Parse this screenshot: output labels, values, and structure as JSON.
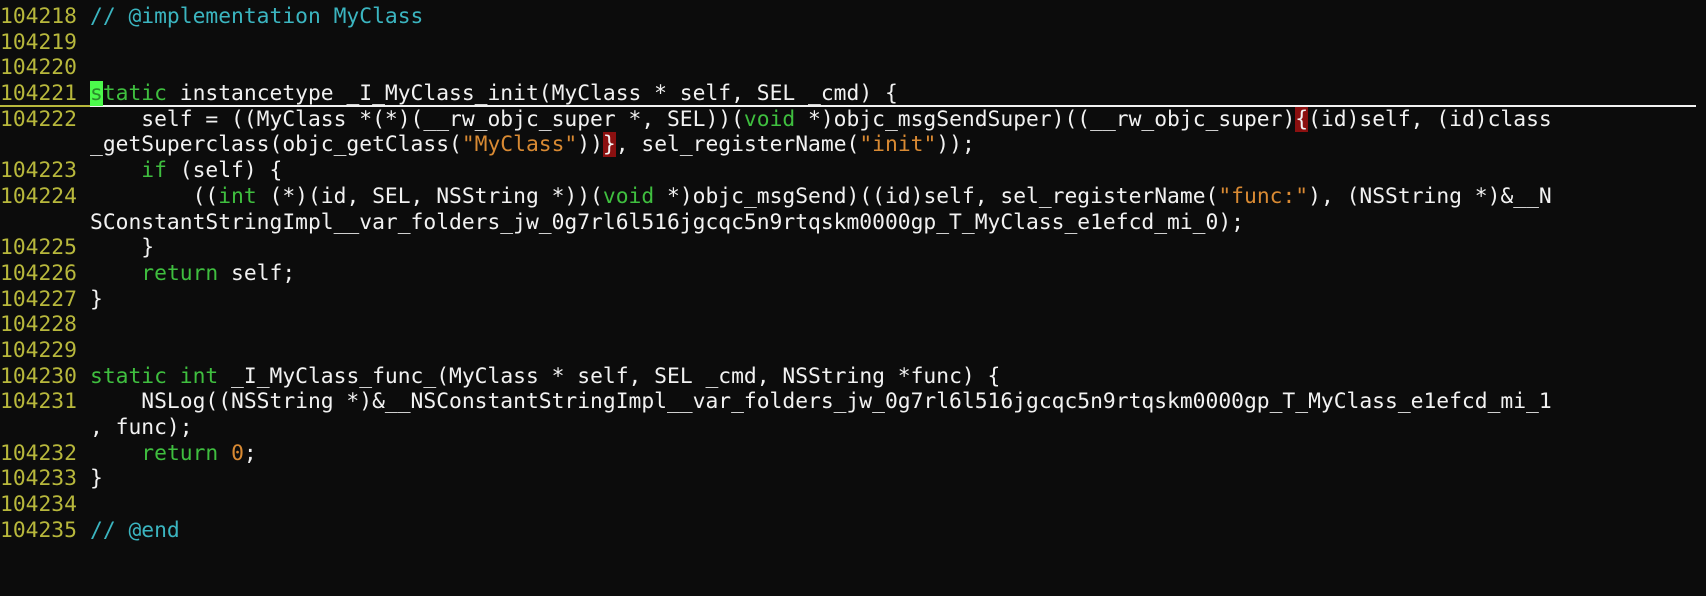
{
  "editor": {
    "colors": {
      "background": "#0c0c0c",
      "line_number": "#b8b83c",
      "comment": "#3bb5c0",
      "keyword": "#3fbf3f",
      "string": "#d98a33",
      "match_bracket_bg": "#8b1010",
      "cursor": "#4cfa4c"
    },
    "rows": [
      {
        "num": "104218",
        "segs": [
          [
            "// @implementation MyClass",
            "comment"
          ]
        ]
      },
      {
        "num": "104219",
        "segs": []
      },
      {
        "num": "104220",
        "segs": []
      },
      {
        "num": "104221",
        "cursorline": true,
        "segs": [
          [
            "s",
            "cursor kw"
          ],
          [
            "tatic",
            "kw"
          ],
          [
            " instancetype _I_MyClass_init(MyClass * self, SEL _cmd) {",
            ""
          ]
        ]
      },
      {
        "num": "104222",
        "segs": [
          [
            "    self = ((MyClass *(*)(__rw_objc_super *, SEL))(",
            ""
          ],
          [
            "void",
            "kw"
          ],
          [
            " *)objc_msgSendSuper)((__rw_objc_super)",
            ""
          ],
          [
            "{",
            "match"
          ],
          [
            "(id)self, (id)class",
            ""
          ]
        ]
      },
      {
        "num": "",
        "segs": [
          [
            "_getSuperclass(objc_getClass(",
            ""
          ],
          [
            "\"MyClass\"",
            "str"
          ],
          [
            "))",
            ""
          ],
          [
            "}",
            "match"
          ],
          [
            ", sel_registerName(",
            ""
          ],
          [
            "\"init\"",
            "str"
          ],
          [
            "));",
            ""
          ]
        ]
      },
      {
        "num": "104223",
        "segs": [
          [
            "    ",
            ""
          ],
          [
            "if",
            "kw"
          ],
          [
            " (self) {",
            ""
          ]
        ]
      },
      {
        "num": "104224",
        "segs": [
          [
            "        ((",
            ""
          ],
          [
            "int",
            "kw"
          ],
          [
            " (*)(id, SEL, NSString *))(",
            ""
          ],
          [
            "void",
            "kw"
          ],
          [
            " *)objc_msgSend)((id)self, sel_registerName(",
            ""
          ],
          [
            "\"func:\"",
            "str"
          ],
          [
            "), (NSString *)&__N",
            ""
          ]
        ]
      },
      {
        "num": "",
        "segs": [
          [
            "SConstantStringImpl__var_folders_jw_0g7rl6l516jgcqc5n9rtqskm0000gp_T_MyClass_e1efcd_mi_0);",
            ""
          ]
        ]
      },
      {
        "num": "104225",
        "segs": [
          [
            "    }",
            ""
          ]
        ]
      },
      {
        "num": "104226",
        "segs": [
          [
            "    ",
            ""
          ],
          [
            "return",
            "kw"
          ],
          [
            " self;",
            ""
          ]
        ]
      },
      {
        "num": "104227",
        "segs": [
          [
            "}",
            ""
          ]
        ]
      },
      {
        "num": "104228",
        "segs": []
      },
      {
        "num": "104229",
        "segs": []
      },
      {
        "num": "104230",
        "segs": [
          [
            "static",
            "kw"
          ],
          [
            " ",
            ""
          ],
          [
            "int",
            "kw"
          ],
          [
            " _I_MyClass_func_(MyClass * self, SEL _cmd, NSString *func) {",
            ""
          ]
        ]
      },
      {
        "num": "104231",
        "segs": [
          [
            "    NSLog((NSString *)&__NSConstantStringImpl__var_folders_jw_0g7rl6l516jgcqc5n9rtqskm0000gp_T_MyClass_e1efcd_mi_1",
            ""
          ]
        ]
      },
      {
        "num": "",
        "segs": [
          [
            ", func);",
            ""
          ]
        ]
      },
      {
        "num": "104232",
        "segs": [
          [
            "    ",
            ""
          ],
          [
            "return",
            "kw"
          ],
          [
            " ",
            ""
          ],
          [
            "0",
            "numlit"
          ],
          [
            ";",
            ""
          ]
        ]
      },
      {
        "num": "104233",
        "segs": [
          [
            "}",
            ""
          ]
        ]
      },
      {
        "num": "104234",
        "segs": []
      },
      {
        "num": "104235",
        "segs": [
          [
            "// @end",
            "comment"
          ]
        ]
      }
    ]
  }
}
